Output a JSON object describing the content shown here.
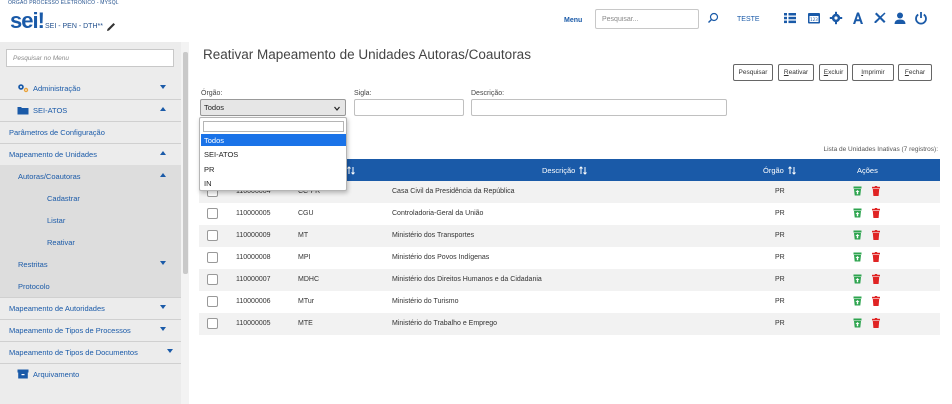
{
  "header": {
    "org": "ÓRGÃO PROCESSO ELETRÔNICO - MYSQL",
    "logo": "sei",
    "logo_bang": "!",
    "subtitle": "SEI - PEN - DTH**",
    "menu_label": "Menu",
    "search_placeholder": "Pesquisar...",
    "user": "TESTE"
  },
  "sidebar": {
    "search_placeholder": "Pesquisar no Menu",
    "items": [
      {
        "label": "Administração",
        "icon": "gears-icon",
        "expanded": false
      },
      {
        "label": "SEI-ATOS",
        "icon": "folder-icon",
        "expanded": true
      },
      {
        "label": "Parâmetros de Configuração"
      },
      {
        "label": "Mapeamento de Unidades",
        "expanded": true
      },
      {
        "label": "Autoras/Coautoras",
        "expanded": true
      },
      {
        "label": "Cadastrar"
      },
      {
        "label": "Listar"
      },
      {
        "label": "Reativar"
      },
      {
        "label": "Restritas",
        "expanded": false
      },
      {
        "label": "Protocolo"
      },
      {
        "label": "Mapeamento de Autoridades",
        "expanded": false
      },
      {
        "label": "Mapeamento de Tipos de Processos",
        "expanded": false
      },
      {
        "label": "Mapeamento de Tipos de Documentos",
        "expanded": false
      },
      {
        "label": "Arquivamento",
        "icon": "archive-icon"
      }
    ]
  },
  "main": {
    "title": "Reativar Mapeamento de Unidades Autoras/Coautoras",
    "buttons": [
      {
        "first": "P",
        "rest": "esquisar",
        "underline_first": false,
        "label": "Pesquisar"
      },
      {
        "first": "R",
        "rest": "eativar",
        "underline_first": true,
        "label": "Reativar"
      },
      {
        "first": "E",
        "rest": "xcluir",
        "underline_first": true,
        "label": "Excluir"
      },
      {
        "first": "I",
        "rest": "mprimir",
        "underline_first": true,
        "label": "Imprimir"
      },
      {
        "first": "F",
        "rest": "echar",
        "underline_first": true,
        "label": "Fechar"
      }
    ],
    "filters": {
      "orgao_label": "Órgão:",
      "orgao_value": "Todos",
      "sigla_label": "Sigla:",
      "sigla_value": "",
      "descricao_label": "Descrição:",
      "descricao_value": ""
    },
    "dropdown_options": [
      "Todos",
      "SEI-ATOS",
      "PR",
      "IN"
    ],
    "dropdown_selected": "Todos",
    "table_caption": "Lista de Unidades Inativas (7 registros):",
    "columns": [
      "",
      "",
      "Sigla",
      "Descrição",
      "Órgão",
      "Ações"
    ],
    "rows": [
      {
        "id": "110000004",
        "sigla": "CC-PR",
        "descricao": "Casa Civil da Presidência da República",
        "orgao": "PR"
      },
      {
        "id": "110000005",
        "sigla": "CGU",
        "descricao": "Controladoria-Geral da União",
        "orgao": "PR"
      },
      {
        "id": "110000009",
        "sigla": "MT",
        "descricao": "Ministério dos Transportes",
        "orgao": "PR"
      },
      {
        "id": "110000008",
        "sigla": "MPI",
        "descricao": "Ministério dos Povos Indígenas",
        "orgao": "PR"
      },
      {
        "id": "110000007",
        "sigla": "MDHC",
        "descricao": "Ministério dos Direitos Humanos e da Cidadania",
        "orgao": "PR"
      },
      {
        "id": "110000006",
        "sigla": "MTur",
        "descricao": "Ministério do Turismo",
        "orgao": "PR"
      },
      {
        "id": "110000005",
        "sigla": "MTE",
        "descricao": "Ministério do Trabalho e Emprego",
        "orgao": "PR"
      }
    ]
  },
  "colors": {
    "brand": "#1a5aa8",
    "header_bg": "#1a5aa8",
    "selected_option": "#1a73e8",
    "restore_green": "#2ea44f",
    "delete_red": "#e02424"
  }
}
